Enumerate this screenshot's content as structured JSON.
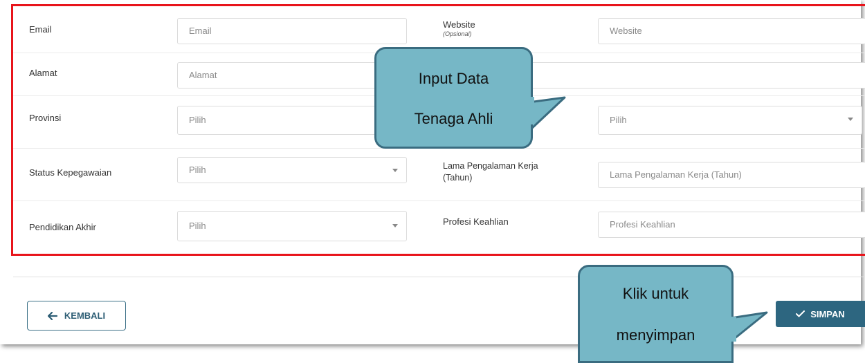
{
  "form": {
    "email": {
      "label": "Email",
      "placeholder": "Email"
    },
    "website": {
      "label": "Website",
      "sublabel": "(Opsional)",
      "placeholder": "Website"
    },
    "alamat": {
      "label": "Alamat",
      "placeholder": "Alamat"
    },
    "provinsi": {
      "label": "Provinsi",
      "placeholder": "Pilih"
    },
    "kabupaten": {
      "placeholder": "Pilih"
    },
    "status_kepegawaian": {
      "label": "Status Kepegawaian",
      "placeholder": "Pilih"
    },
    "lama_pengalaman": {
      "label_line1": "Lama Pengalaman Kerja",
      "label_line2": "(Tahun)",
      "placeholder": "Lama Pengalaman Kerja (Tahun)"
    },
    "pendidikan_akhir": {
      "label": "Pendidikan Akhir",
      "placeholder": "Pilih"
    },
    "profesi_keahlian": {
      "label": "Profesi Keahlian",
      "placeholder": "Profesi Keahlian"
    }
  },
  "buttons": {
    "back_label": "KEMBALI",
    "save_label": "SIMPAN"
  },
  "callouts": {
    "input_line1": "Input Data",
    "input_line2": "Tenaga Ahli",
    "save_line1": "Klik untuk",
    "save_line2": "menyimpan"
  },
  "icons": {
    "back": "arrow-left-icon",
    "save": "check-icon",
    "dropdown": "caret-down-icon"
  },
  "colors": {
    "highlight_border": "#e8141b",
    "primary": "#2d6680",
    "callout_fill": "#76b7c6",
    "callout_border": "#3a6c80"
  }
}
